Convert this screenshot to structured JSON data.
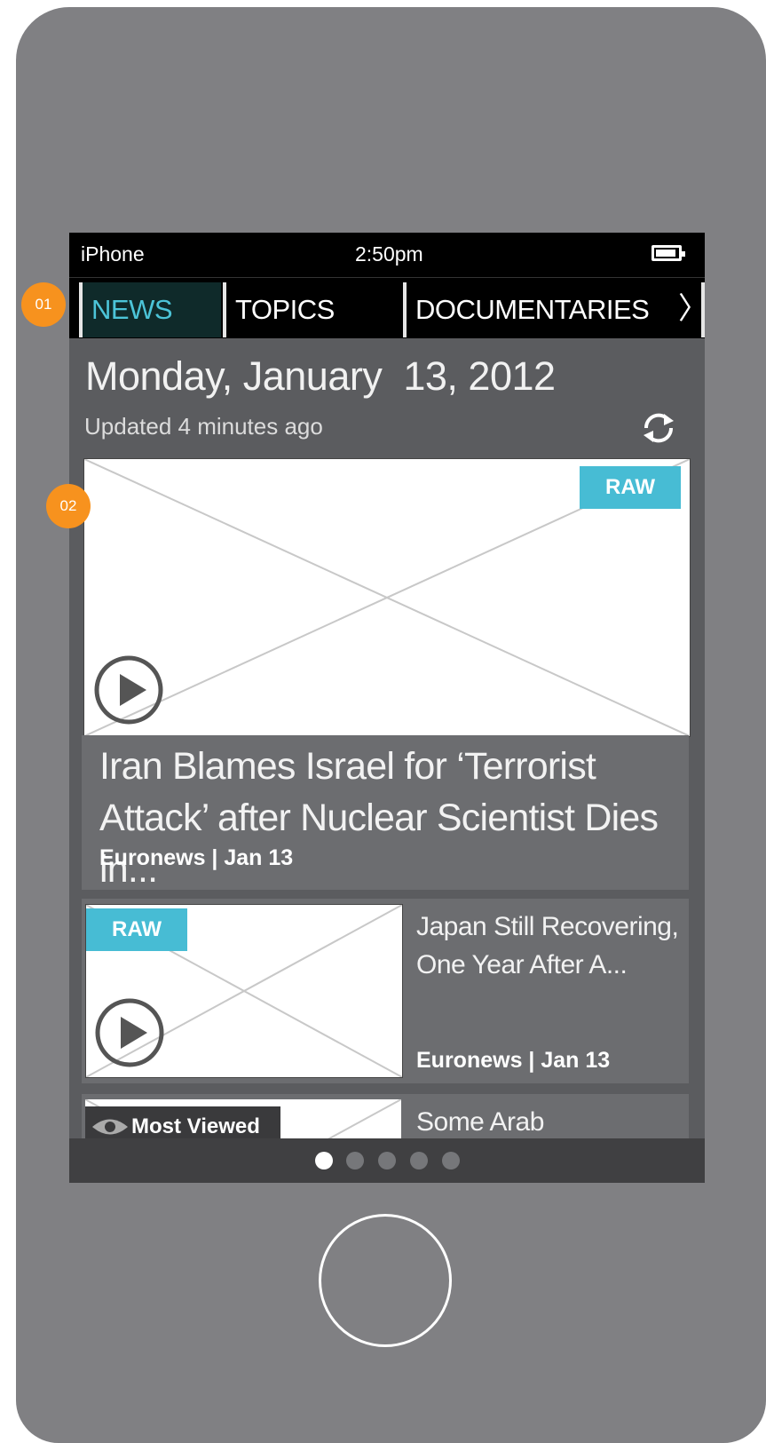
{
  "status_bar": {
    "carrier": "iPhone",
    "time": "2:50pm",
    "battery_icon": "battery-icon"
  },
  "tabs": [
    {
      "label": "NEWS",
      "active": true
    },
    {
      "label": "TOPICS",
      "active": false
    },
    {
      "label": "DOCUMENTARIES",
      "active": false
    }
  ],
  "tab_more_icon": "chevron-right-icon",
  "header": {
    "date": "Monday, January  13, 2012",
    "updated": "Updated 4 minutes ago",
    "refresh_icon": "refresh-icon"
  },
  "featured": {
    "badge": "RAW",
    "headline": "Iran Blames Israel for ‘Terrorist Attack’ after Nuclear Scientist Dies in...",
    "meta": "Euronews | Jan 13",
    "play_icon": "play-icon"
  },
  "stories": [
    {
      "badge": "RAW",
      "title": "Japan Still Recovering, One Year After A...",
      "meta": "Euronews | Jan 13"
    },
    {
      "badge": "Most Viewed",
      "badge_icon": "eye-icon",
      "title": "Some Arab"
    }
  ],
  "pager": {
    "count": 5,
    "active_index": 0
  },
  "annotations": [
    "01",
    "02"
  ],
  "colors": {
    "accent": "#47bcd4",
    "annotation": "#f7921e",
    "active_tab_bg": "#0f2a2a",
    "active_tab_text": "#4cc4d8"
  }
}
